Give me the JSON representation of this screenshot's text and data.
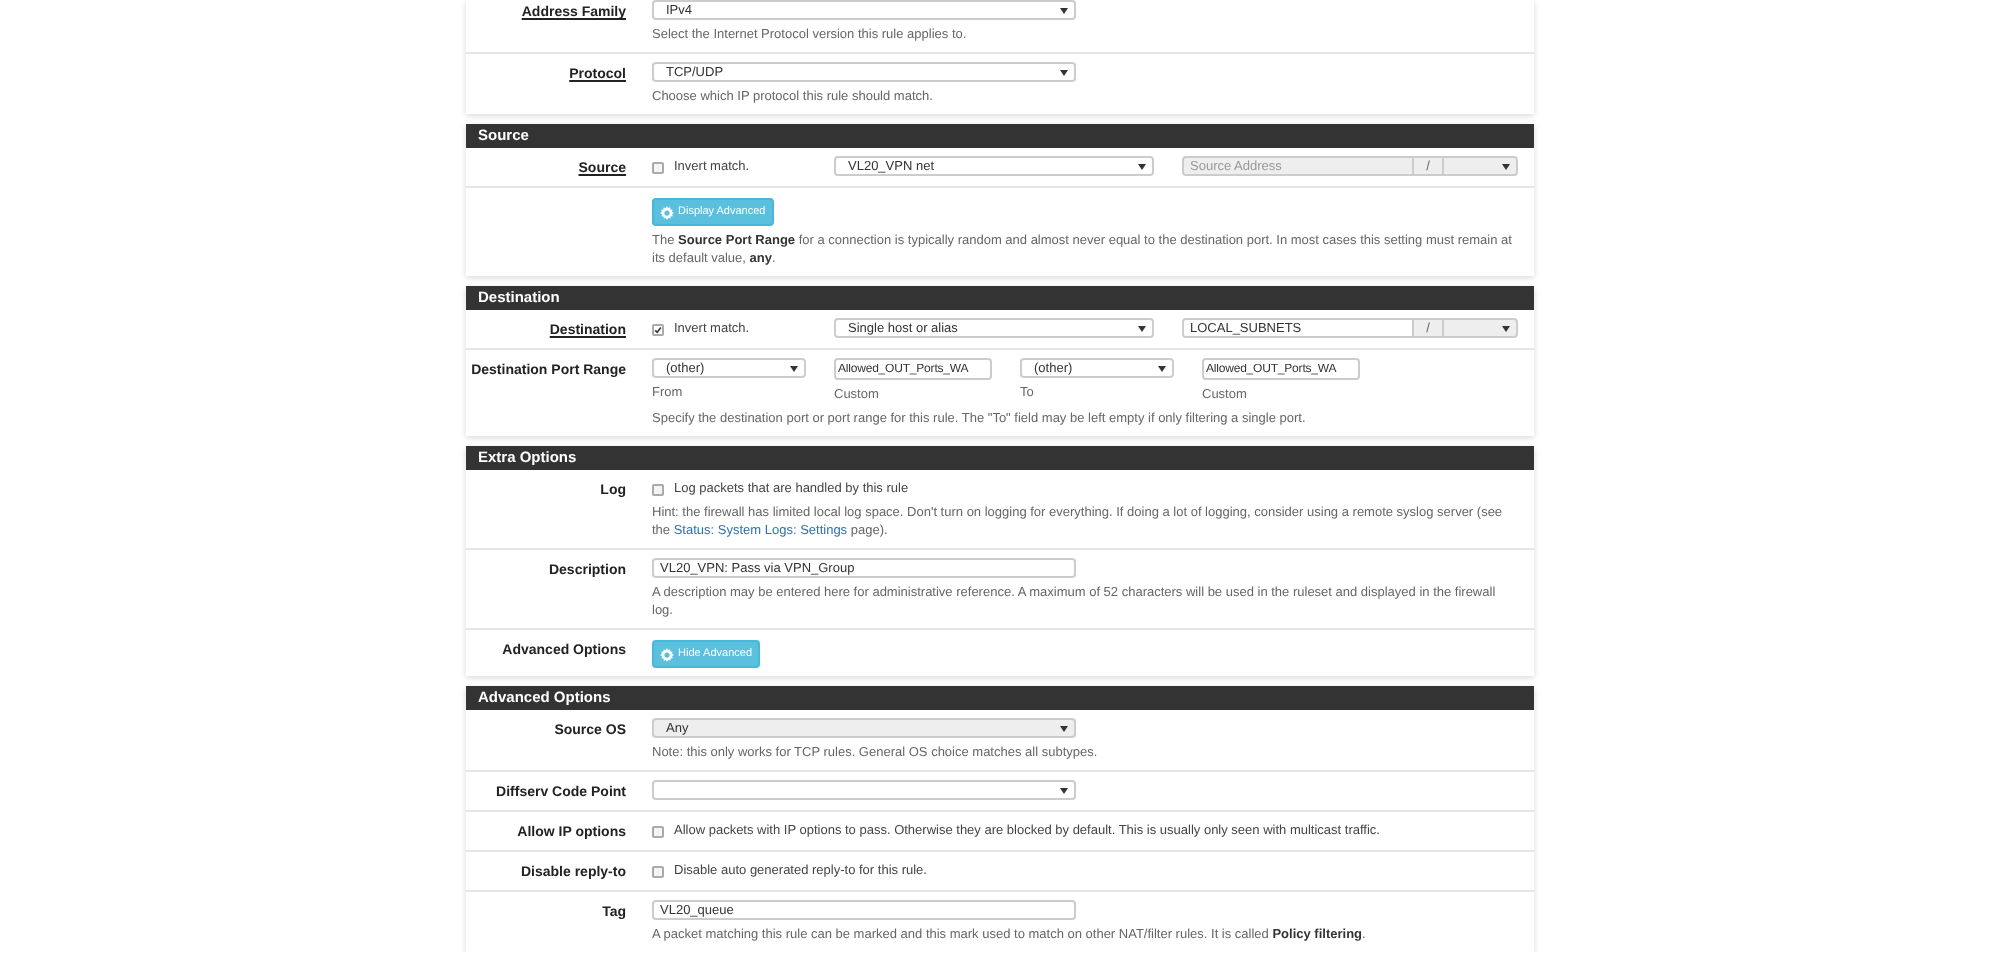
{
  "sections": [
    {
      "rows": [
        {
          "kind": "select",
          "label": "Address Family",
          "underlined": true,
          "value": "IPv4",
          "disabled": false,
          "help": "Select the Internet Protocol version this rule applies to."
        },
        {
          "kind": "select",
          "label": "Protocol",
          "underlined": true,
          "value": "TCP/UDP",
          "disabled": false,
          "help": "Choose which IP protocol this rule should match."
        }
      ]
    },
    {
      "title": "Source",
      "rows": [
        {
          "kind": "address",
          "label": "Source",
          "underlined": true,
          "invert": {
            "label": "Invert match.",
            "checked": false
          },
          "type": "VL20_VPN net",
          "address": {
            "placeholder": "Source Address",
            "disabled": true
          },
          "slash": "/"
        },
        {
          "kind": "button",
          "button": "Display Advanced",
          "help": "The **Source Port Range** for a connection is typically random and almost never equal to the destination port. In most cases this setting must remain at its default value, **any**."
        }
      ]
    },
    {
      "title": "Destination",
      "rows": [
        {
          "kind": "address",
          "label": "Destination",
          "underlined": true,
          "invert": {
            "label": "Invert match.",
            "checked": true
          },
          "type": "Single host or alias",
          "address": {
            "value": "LOCAL_SUBNETS",
            "disabled": false
          },
          "slash": "/"
        },
        {
          "kind": "ports",
          "label": "Destination Port Range",
          "underlined": false,
          "fields": [
            {
              "kind": "select",
              "value": "(other)",
              "caption": "From"
            },
            {
              "kind": "input",
              "value": "Allowed_OUT_Ports_WA",
              "caption": "Custom"
            },
            {
              "kind": "select",
              "value": "(other)",
              "caption": "To"
            },
            {
              "kind": "input",
              "value": "Allowed_OUT_Ports_WA",
              "caption": "Custom"
            }
          ],
          "help": "Specify the destination port or port range for this rule. The \"To\" field may be left empty if only filtering a single port."
        }
      ]
    },
    {
      "title": "Extra Options",
      "rows": [
        {
          "kind": "checkbox",
          "label": "Log",
          "underlined": false,
          "checked": false,
          "text": "Log packets that are handled by this rule",
          "help": {
            "before": "Hint: the firewall has limited local log space. Don't turn on logging for everything. If doing a lot of logging, consider using a remote syslog server (see the",
            "link": "Status: System Logs: Settings",
            "after": "page)."
          }
        },
        {
          "kind": "input",
          "label": "Description",
          "underlined": false,
          "value": "VL20_VPN: Pass via VPN_Group",
          "help": "A description may be entered here for administrative reference. A maximum of 52 characters will be used in the ruleset and displayed in the firewall log."
        },
        {
          "kind": "button",
          "label": "Advanced Options",
          "button": "Hide Advanced"
        }
      ]
    },
    {
      "title": "Advanced Options",
      "rows": [
        {
          "kind": "select",
          "label": "Source OS",
          "underlined": false,
          "value": "Any",
          "disabled": true,
          "help": "Note: this only works for TCP rules. General OS choice matches all subtypes."
        },
        {
          "kind": "select",
          "label": "Diffserv Code Point",
          "underlined": false,
          "disabled": false
        },
        {
          "kind": "checkbox",
          "label": "Allow IP options",
          "underlined": false,
          "checked": false,
          "text": "Allow packets with IP options to pass. Otherwise they are blocked by default. This is usually only seen with multicast traffic."
        },
        {
          "kind": "checkbox",
          "label": "Disable reply-to",
          "underlined": false,
          "checked": false,
          "text": "Disable auto generated reply-to for this rule."
        },
        {
          "kind": "input",
          "label": "Tag",
          "underlined": false,
          "value": "VL20_queue",
          "help": "A packet matching this rule can be marked and this mark used to match on other NAT/filter rules. It is called **Policy filtering**."
        }
      ]
    }
  ]
}
